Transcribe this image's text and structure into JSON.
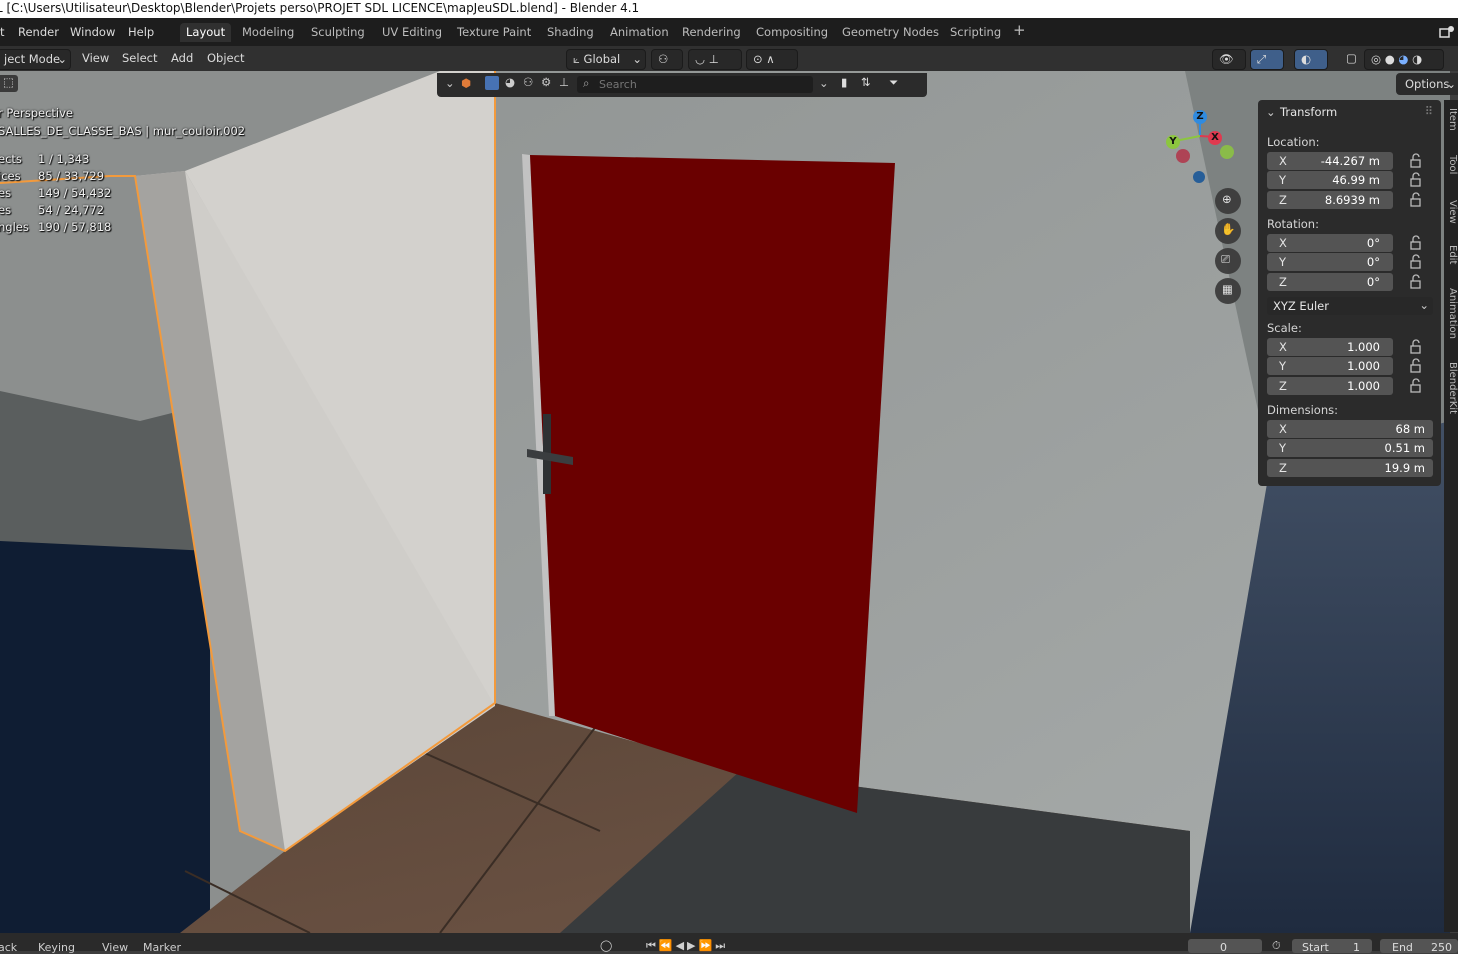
{
  "titlebar": {
    "title": "L [C:\\Users\\Utilisateur\\Desktop\\Blender\\Projets perso\\PROJET SDL LICENCE\\mapJeuSDL.blend] - Blender 4.1"
  },
  "menus": [
    "t",
    "Render",
    "Window",
    "Help"
  ],
  "workspaces": [
    "Layout",
    "Modeling",
    "Sculpting",
    "UV Editing",
    "Texture Paint",
    "Shading",
    "Animation",
    "Rendering",
    "Compositing",
    "Geometry Nodes",
    "Scripting",
    "+"
  ],
  "active_workspace": "Layout",
  "header": {
    "mode": "ject Mode",
    "menus": [
      "View",
      "Select",
      "Add",
      "Object"
    ],
    "transform_orientation": "Global",
    "options_label": "Options"
  },
  "outliner_filter": {
    "search_placeholder": "Search"
  },
  "viewport": {
    "view_name": "r Perspective",
    "collection_path": "SALLES_DE_CLASSE_BAS | mur_couloir.002",
    "stats": [
      {
        "label": "ects",
        "value": "1 / 1,343"
      },
      {
        "label": "ices",
        "value": "85 / 33,729"
      },
      {
        "label": "es",
        "value": "149 / 54,432"
      },
      {
        "label": "es",
        "value": "54 / 24,772"
      },
      {
        "label": "ngles",
        "value": "190 / 57,818"
      }
    ],
    "gizmo_axes": {
      "z": "Z",
      "y": "Y",
      "x": "X"
    }
  },
  "npanel": {
    "title": "Transform",
    "location_label": "Location:",
    "location": [
      {
        "axis": "X",
        "value": "-44.267 m"
      },
      {
        "axis": "Y",
        "value": "46.99 m"
      },
      {
        "axis": "Z",
        "value": "8.6939 m"
      }
    ],
    "rotation_label": "Rotation:",
    "rotation": [
      {
        "axis": "X",
        "value": "0°"
      },
      {
        "axis": "Y",
        "value": "0°"
      },
      {
        "axis": "Z",
        "value": "0°"
      }
    ],
    "rotation_mode": "XYZ Euler",
    "scale_label": "Scale:",
    "scale": [
      {
        "axis": "X",
        "value": "1.000"
      },
      {
        "axis": "Y",
        "value": "1.000"
      },
      {
        "axis": "Z",
        "value": "1.000"
      }
    ],
    "dimensions_label": "Dimensions:",
    "dimensions": [
      {
        "axis": "X",
        "value": "68 m"
      },
      {
        "axis": "Y",
        "value": "0.51 m"
      },
      {
        "axis": "Z",
        "value": "19.9 m"
      }
    ]
  },
  "side_tabs": [
    "Item",
    "Tool",
    "View",
    "Edit",
    "Animation",
    "BlenderKit"
  ],
  "timeline": {
    "left_items": [
      "ack",
      "Keying",
      "View",
      "Marker"
    ],
    "current_frame": "0",
    "start_label": "Start",
    "start_value": "1",
    "end_label": "End",
    "end_value": "250"
  },
  "colors": {
    "door": "#6a0000",
    "selection_outline": "#f39a3c",
    "axis_x": "#e0394f",
    "axis_y": "#8cc63f",
    "axis_z": "#2f8be0"
  }
}
